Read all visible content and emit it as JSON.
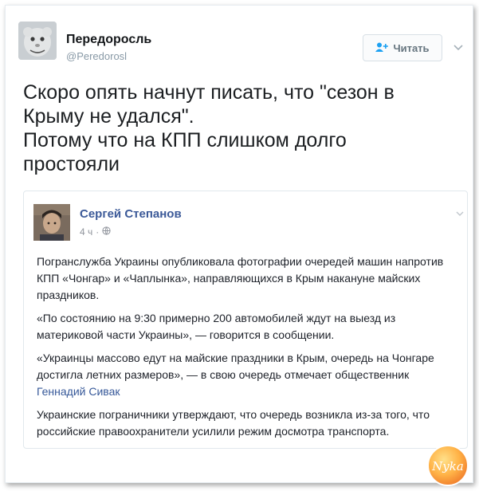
{
  "tweet": {
    "author": {
      "name": "Передоросль",
      "handle": "@Peredorosl"
    },
    "follow_label": "Читать",
    "text_lines": [
      "Скоро опять начнут писать, что \"сезон в",
      "Крыму не удался\".",
      "Потому что на КПП слишком долго",
      "простояли"
    ]
  },
  "embed": {
    "author_name": "Сергей Степанов",
    "time": "4 ч",
    "paragraphs": [
      "Погранслужба Украины опубликовала фотографии очередей машин напротив КПП «Чонгар» и «Чаплынка», направляющихся в Крым накануне майских праздников.",
      "«По состоянию на 9:30 примерно 200 автомобилей ждут на выезд из материковой части Украины», — говорится в сообщении.",
      "«Украинцы массово едут на майские праздники в Крым, очередь на Чонгаре достигла летних размеров», — в свою очередь отмечает общественник",
      "Украинские пограничники утверждают, что очередь возникла из-за того, что российские правоохранители усилили режим досмотра транспорта."
    ],
    "mention": "Геннадий Сивак"
  },
  "watermark": {
    "text": "Nyka"
  },
  "icons": {
    "follow": "add-user-icon",
    "menu": "chevron-down-icon",
    "privacy": "globe-icon"
  },
  "colors": {
    "link": "#365899",
    "fb_name": "#3b5998",
    "muted": "#8899a6"
  }
}
